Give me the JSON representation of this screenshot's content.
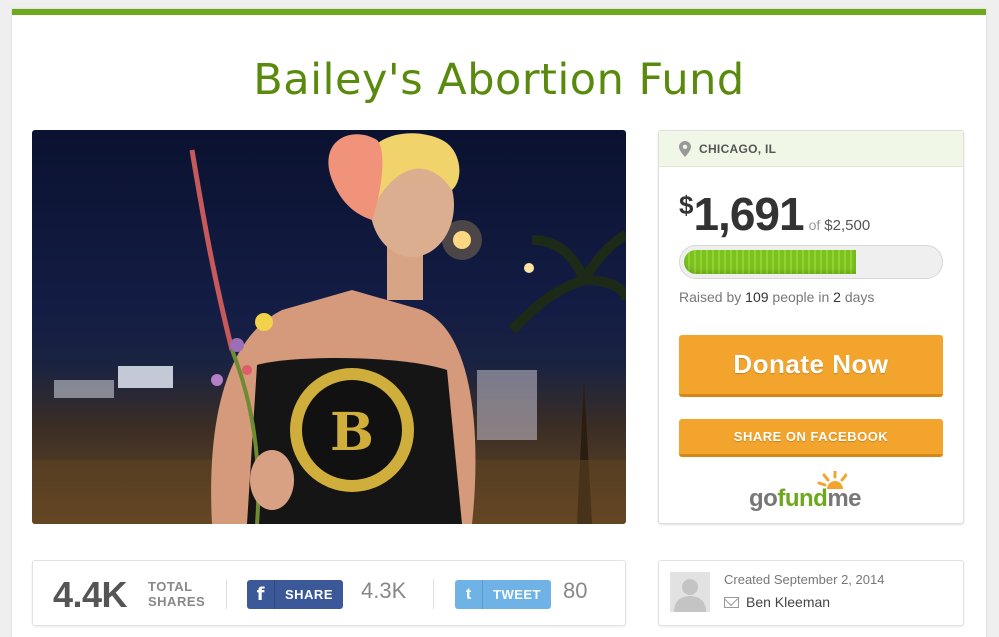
{
  "campaign": {
    "title": "Bailey's Abortion Fund",
    "photo_alt": "Campaign photo"
  },
  "stats": {
    "location": "CHICAGO, IL",
    "currency_symbol": "$",
    "raised_amount": "1,691",
    "of_label": "of",
    "goal_amount": "$2,500",
    "progress_fraction": 0.6764,
    "raised_prefix": "Raised by",
    "people_count": "109",
    "people_label": "people in",
    "days_count": "2",
    "days_label": "days",
    "donate_label": "Donate Now",
    "share_fb_label": "SHARE ON FACEBOOK",
    "logo_go": "go",
    "logo_fund": "fund",
    "logo_me": "me"
  },
  "share_bar": {
    "total_count": "4.4K",
    "total_label_line1": "TOTAL",
    "total_label_line2": "SHARES",
    "fb_icon_glyph": "f",
    "fb_label": "SHARE",
    "fb_count": "4.3K",
    "tw_icon_glyph": "t",
    "tw_label": "TWEET",
    "tw_count": "80"
  },
  "creator": {
    "created_text": "Created September 2, 2014",
    "name": "Ben Kleeman"
  },
  "colors": {
    "brand_green": "#6ea81c",
    "title_green": "#5a8a0d",
    "donate_orange": "#f2a42c",
    "facebook_blue": "#3b5998",
    "twitter_blue": "#6fb2e6"
  }
}
